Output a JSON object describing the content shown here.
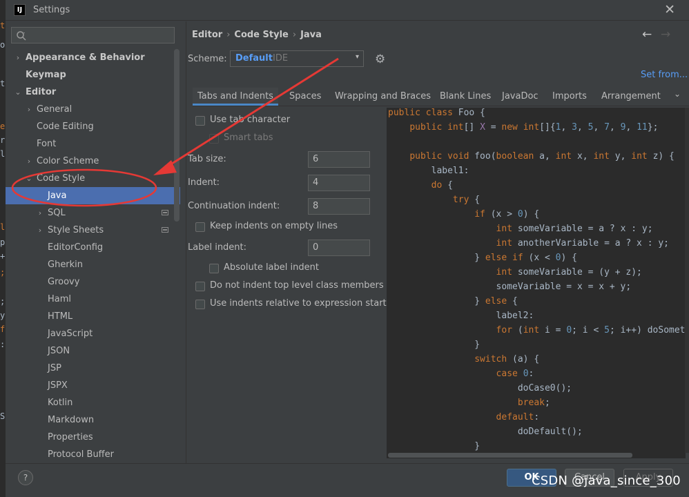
{
  "background_strip": [
    "t",
    "o",
    "t",
    "e",
    "r",
    "l",
    "l",
    "p",
    "+",
    ";",
    ";",
    "y",
    "f",
    ":",
    "S"
  ],
  "window": {
    "title": "Settings",
    "app_icon": "IJ",
    "icons": {
      "app": "intellij-icon",
      "close": "close-icon"
    }
  },
  "sidebar": {
    "search_placeholder": "",
    "items": [
      {
        "label": "Appearance & Behavior",
        "arrow": "›",
        "bold": true
      },
      {
        "label": "Keymap",
        "arrow": "",
        "bold": true
      },
      {
        "label": "Editor",
        "arrow": "⌄",
        "bold": true
      },
      {
        "label": "General",
        "arrow": "›"
      },
      {
        "label": "Code Editing",
        "arrow": ""
      },
      {
        "label": "Font",
        "arrow": ""
      },
      {
        "label": "Color Scheme",
        "arrow": "›"
      },
      {
        "label": "Code Style",
        "arrow": "⌄"
      },
      {
        "label": "Java",
        "arrow": "",
        "selected": true
      },
      {
        "label": "SQL",
        "arrow": "›",
        "badge": true
      },
      {
        "label": "Style Sheets",
        "arrow": "›",
        "badge": true
      },
      {
        "label": "EditorConfig",
        "arrow": ""
      },
      {
        "label": "Gherkin",
        "arrow": ""
      },
      {
        "label": "Groovy",
        "arrow": ""
      },
      {
        "label": "Haml",
        "arrow": ""
      },
      {
        "label": "HTML",
        "arrow": ""
      },
      {
        "label": "JavaScript",
        "arrow": ""
      },
      {
        "label": "JSON",
        "arrow": ""
      },
      {
        "label": "JSP",
        "arrow": ""
      },
      {
        "label": "JSPX",
        "arrow": ""
      },
      {
        "label": "Kotlin",
        "arrow": ""
      },
      {
        "label": "Markdown",
        "arrow": ""
      },
      {
        "label": "Properties",
        "arrow": ""
      },
      {
        "label": "Protocol Buffer",
        "arrow": ""
      }
    ]
  },
  "breadcrumb": {
    "items": [
      "Editor",
      "Code Style",
      "Java"
    ],
    "separator": "›"
  },
  "nav": {
    "back": "←",
    "forward": "→"
  },
  "scheme": {
    "label": "Scheme:",
    "value": "Default",
    "tag": "IDE",
    "caret": "▾",
    "gear": "⚙"
  },
  "set_from": "Set from...",
  "tabs": {
    "items": [
      "Tabs and Indents",
      "Spaces",
      "Wrapping and Braces",
      "Blank Lines",
      "JavaDoc",
      "Imports",
      "Arrangement"
    ],
    "active_index": 0,
    "more": "⌄"
  },
  "form": {
    "use_tab_character": {
      "label": "Use tab character",
      "checked": false
    },
    "smart_tabs": {
      "label": "Smart tabs",
      "checked": false,
      "disabled": true
    },
    "tab_size": {
      "label": "Tab size:",
      "value": "6"
    },
    "indent": {
      "label": "Indent:",
      "value": "4"
    },
    "continuation_indent": {
      "label": "Continuation indent:",
      "value": "8"
    },
    "keep_indents": {
      "label": "Keep indents on empty lines",
      "checked": false
    },
    "label_indent": {
      "label": "Label indent:",
      "value": "0"
    },
    "absolute_label_indent": {
      "label": "Absolute label indent",
      "checked": false
    },
    "no_indent_top_level": {
      "label": "Do not indent top level class members",
      "checked": false
    },
    "indents_relative": {
      "label": "Use indents relative to expression start",
      "checked": false
    }
  },
  "code_preview": [
    {
      "indent": 0,
      "tokens": [
        [
          "kw",
          "public class "
        ],
        [
          "p",
          "Foo {"
        ]
      ]
    },
    {
      "indent": 1,
      "tokens": [
        [
          "kw",
          "public int"
        ],
        [
          "p",
          "[] "
        ],
        [
          "fld",
          "X"
        ],
        [
          "p",
          " = "
        ],
        [
          "kw",
          "new int"
        ],
        [
          "p",
          "[]{"
        ],
        [
          "num",
          "1"
        ],
        [
          "p",
          ", "
        ],
        [
          "num",
          "3"
        ],
        [
          "p",
          ", "
        ],
        [
          "num",
          "5"
        ],
        [
          "p",
          ", "
        ],
        [
          "num",
          "7"
        ],
        [
          "p",
          ", "
        ],
        [
          "num",
          "9"
        ],
        [
          "p",
          ", "
        ],
        [
          "num",
          "11"
        ],
        [
          "p",
          "};"
        ]
      ]
    },
    {
      "indent": 0,
      "tokens": []
    },
    {
      "indent": 1,
      "tokens": [
        [
          "kw",
          "public void "
        ],
        [
          "p",
          "foo("
        ],
        [
          "kw",
          "boolean "
        ],
        [
          "p",
          "a, "
        ],
        [
          "kw",
          "int "
        ],
        [
          "p",
          "x, "
        ],
        [
          "kw",
          "int "
        ],
        [
          "p",
          "y, "
        ],
        [
          "kw",
          "int "
        ],
        [
          "p",
          "z) {"
        ]
      ]
    },
    {
      "indent": 2,
      "tokens": [
        [
          "p",
          "label1:"
        ]
      ]
    },
    {
      "indent": 2,
      "tokens": [
        [
          "kw",
          "do "
        ],
        [
          "p",
          "{"
        ]
      ]
    },
    {
      "indent": 3,
      "tokens": [
        [
          "kw",
          "try "
        ],
        [
          "p",
          "{"
        ]
      ]
    },
    {
      "indent": 4,
      "tokens": [
        [
          "kw",
          "if "
        ],
        [
          "p",
          "(x > "
        ],
        [
          "num",
          "0"
        ],
        [
          "p",
          ") {"
        ]
      ]
    },
    {
      "indent": 5,
      "tokens": [
        [
          "kw",
          "int "
        ],
        [
          "p",
          "someVariable = a ? x : y;"
        ]
      ]
    },
    {
      "indent": 5,
      "tokens": [
        [
          "kw",
          "int "
        ],
        [
          "p",
          "anotherVariable = a ? x : y;"
        ]
      ]
    },
    {
      "indent": 4,
      "tokens": [
        [
          "p",
          "} "
        ],
        [
          "kw",
          "else if "
        ],
        [
          "p",
          "(x < "
        ],
        [
          "num",
          "0"
        ],
        [
          "p",
          ") {"
        ]
      ]
    },
    {
      "indent": 5,
      "tokens": [
        [
          "kw",
          "int "
        ],
        [
          "p",
          "someVariable = (y + z);"
        ]
      ]
    },
    {
      "indent": 5,
      "tokens": [
        [
          "p",
          "someVariable = x = x + y;"
        ]
      ]
    },
    {
      "indent": 4,
      "tokens": [
        [
          "p",
          "} "
        ],
        [
          "kw",
          "else "
        ],
        [
          "p",
          "{"
        ]
      ]
    },
    {
      "indent": 5,
      "tokens": [
        [
          "p",
          "label2:"
        ]
      ]
    },
    {
      "indent": 5,
      "tokens": [
        [
          "kw",
          "for "
        ],
        [
          "p",
          "("
        ],
        [
          "kw",
          "int "
        ],
        [
          "p",
          "i = "
        ],
        [
          "num",
          "0"
        ],
        [
          "p",
          "; i < "
        ],
        [
          "num",
          "5"
        ],
        [
          "p",
          "; i++) doSomet"
        ]
      ]
    },
    {
      "indent": 4,
      "tokens": [
        [
          "p",
          "}"
        ]
      ]
    },
    {
      "indent": 4,
      "tokens": [
        [
          "kw",
          "switch "
        ],
        [
          "p",
          "(a) {"
        ]
      ]
    },
    {
      "indent": 5,
      "tokens": [
        [
          "kw",
          "case "
        ],
        [
          "num",
          "0"
        ],
        [
          "p",
          ":"
        ]
      ]
    },
    {
      "indent": 6,
      "tokens": [
        [
          "p",
          "doCase0();"
        ]
      ]
    },
    {
      "indent": 6,
      "tokens": [
        [
          "kw",
          "break"
        ],
        [
          "p",
          ";"
        ]
      ]
    },
    {
      "indent": 5,
      "tokens": [
        [
          "kw",
          "default"
        ],
        [
          "p",
          ":"
        ]
      ]
    },
    {
      "indent": 6,
      "tokens": [
        [
          "p",
          "doDefault();"
        ]
      ]
    },
    {
      "indent": 4,
      "tokens": [
        [
          "p",
          "}"
        ]
      ]
    }
  ],
  "colors": {
    "accent": "#4b6eaf",
    "link": "#589df6",
    "keyword": "#cc7832",
    "number": "#6897bb",
    "field": "#9876aa",
    "annotation": "#e53935"
  },
  "buttons": {
    "help": "?",
    "ok": "OK",
    "cancel": "Cancel",
    "apply": "Apply"
  },
  "watermark": "CSDN @java_since_300"
}
